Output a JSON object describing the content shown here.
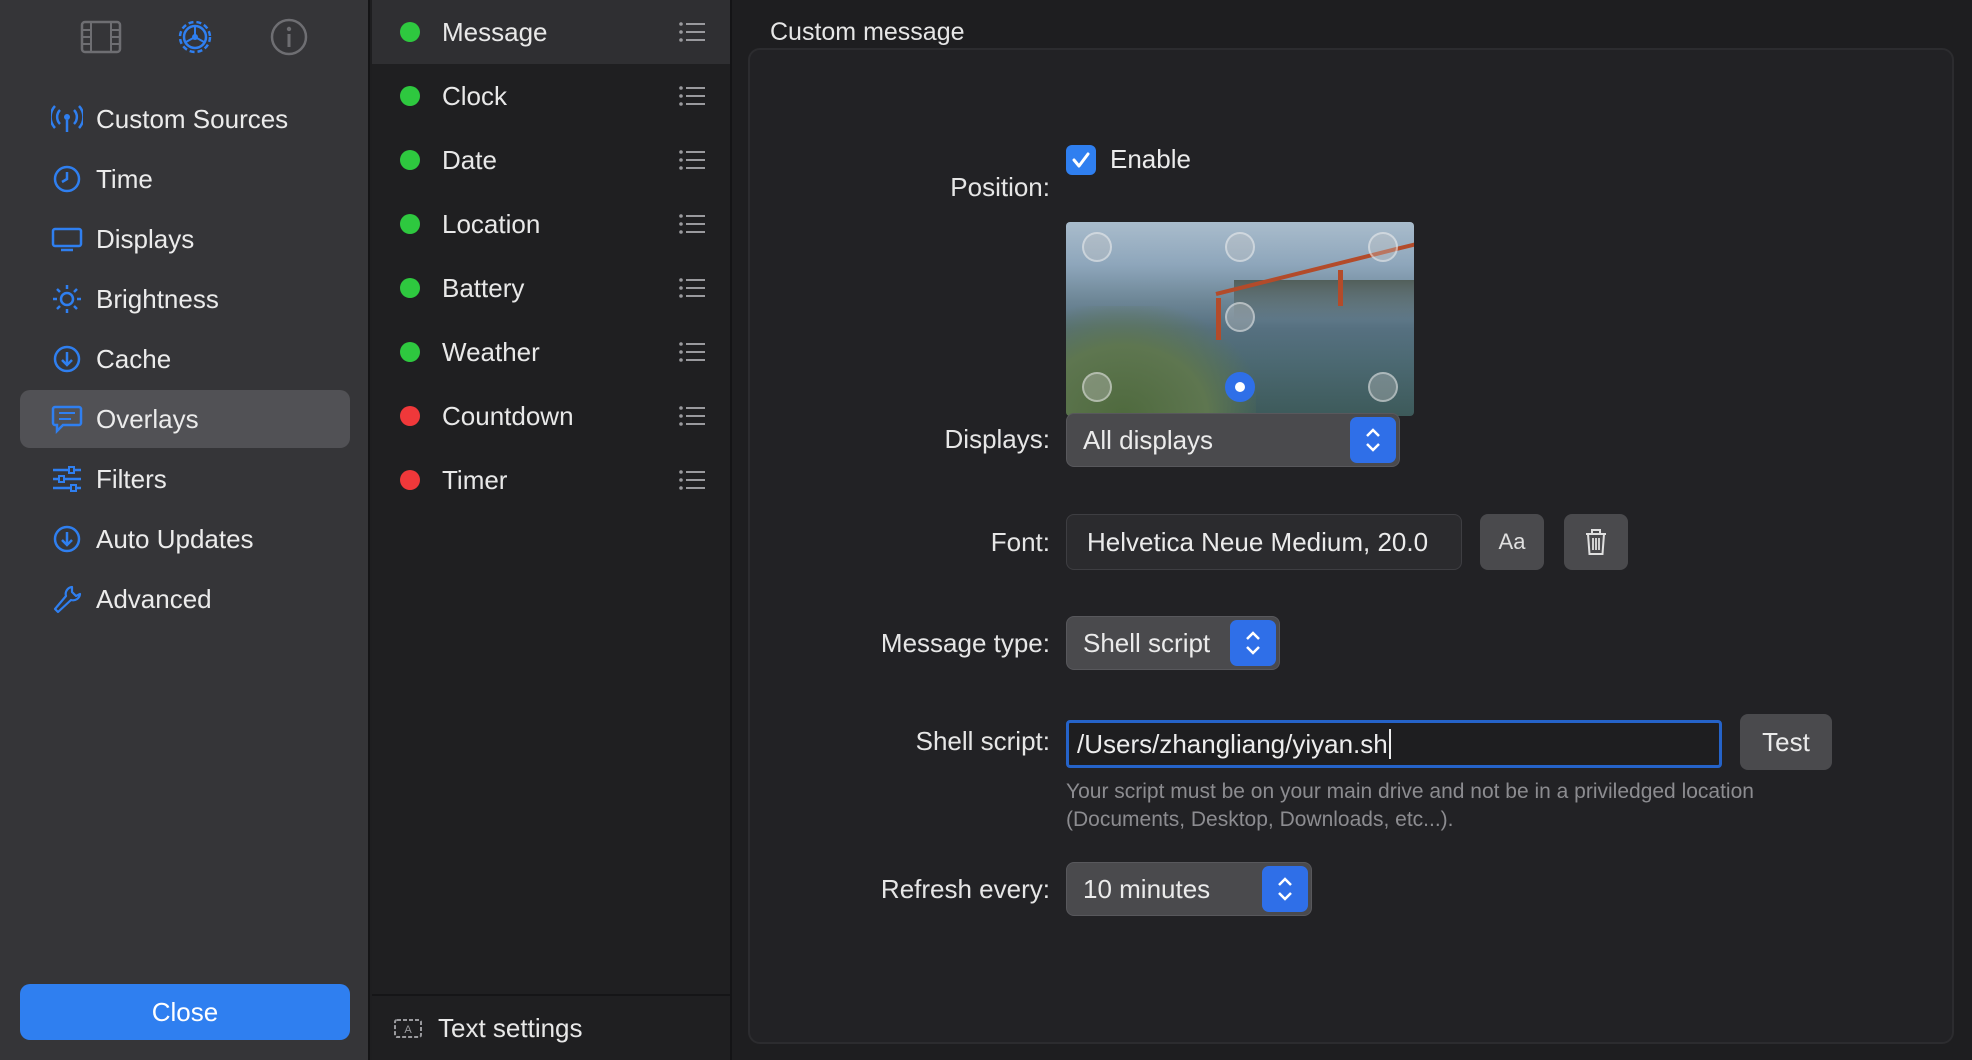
{
  "sidebar": {
    "top_icons": [
      {
        "name": "film-icon",
        "active": false
      },
      {
        "name": "gear-icon",
        "active": true
      },
      {
        "name": "info-icon",
        "active": false
      }
    ],
    "items": [
      {
        "label": "Custom Sources",
        "icon": "antenna-icon",
        "active": false
      },
      {
        "label": "Time",
        "icon": "clock-icon",
        "active": false
      },
      {
        "label": "Displays",
        "icon": "display-icon",
        "active": false
      },
      {
        "label": "Brightness",
        "icon": "sun-icon",
        "active": false
      },
      {
        "label": "Cache",
        "icon": "download-icon",
        "active": false
      },
      {
        "label": "Overlays",
        "icon": "message-icon",
        "active": true
      },
      {
        "label": "Filters",
        "icon": "sliders-icon",
        "active": false
      },
      {
        "label": "Auto Updates",
        "icon": "update-icon",
        "active": false
      },
      {
        "label": "Advanced",
        "icon": "wrench-icon",
        "active": false
      }
    ],
    "close_label": "Close"
  },
  "overlay_list": {
    "items": [
      {
        "label": "Message",
        "status": "enabled",
        "active": true
      },
      {
        "label": "Clock",
        "status": "enabled",
        "active": false
      },
      {
        "label": "Date",
        "status": "enabled",
        "active": false
      },
      {
        "label": "Location",
        "status": "enabled",
        "active": false
      },
      {
        "label": "Battery",
        "status": "enabled",
        "active": false
      },
      {
        "label": "Weather",
        "status": "enabled",
        "active": false
      },
      {
        "label": "Countdown",
        "status": "disabled",
        "active": false
      },
      {
        "label": "Timer",
        "status": "disabled",
        "active": false
      }
    ],
    "footer_label": "Text settings"
  },
  "panel": {
    "title": "Custom message",
    "enable_label": "Enable",
    "enabled": true,
    "position_label": "Position:",
    "position_selected": "bottom-center",
    "displays_label": "Displays:",
    "displays_value": "All displays",
    "font_label": "Font:",
    "font_value": "Helvetica Neue Medium, 20.0",
    "font_button_label": "Aa",
    "message_type_label": "Message type:",
    "message_type_value": "Shell script",
    "shell_script_label": "Shell script:",
    "shell_script_value": "/Users/zhangliang/yiyan.sh",
    "test_label": "Test",
    "hint_line1": "Your script must be on your main drive and not be in a priviledged location",
    "hint_line2": "(Documents, Desktop, Downloads, etc...).",
    "refresh_label": "Refresh every:",
    "refresh_value": "10 minutes"
  },
  "colors": {
    "accent": "#2f7ff0",
    "status_enabled": "#2ec83f",
    "status_disabled": "#f0383a"
  }
}
